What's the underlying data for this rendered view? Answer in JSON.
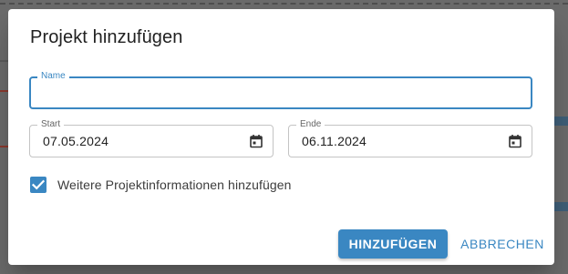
{
  "dialog": {
    "title": "Projekt hinzufügen",
    "name_field": {
      "label": "Name",
      "value": ""
    },
    "start_field": {
      "label": "Start",
      "value": "07.05.2024",
      "icon": "calendar-icon"
    },
    "end_field": {
      "label": "Ende",
      "value": "06.11.2024",
      "icon": "calendar-icon"
    },
    "more_info_checkbox": {
      "label": "Weitere Projektinformationen hinzufügen",
      "checked": true
    },
    "actions": {
      "add_label": "HINZUFÜGEN",
      "cancel_label": "ABBRECHEN"
    },
    "colors": {
      "accent": "#3a87c2",
      "backdrop": "#6b6b6b"
    }
  }
}
